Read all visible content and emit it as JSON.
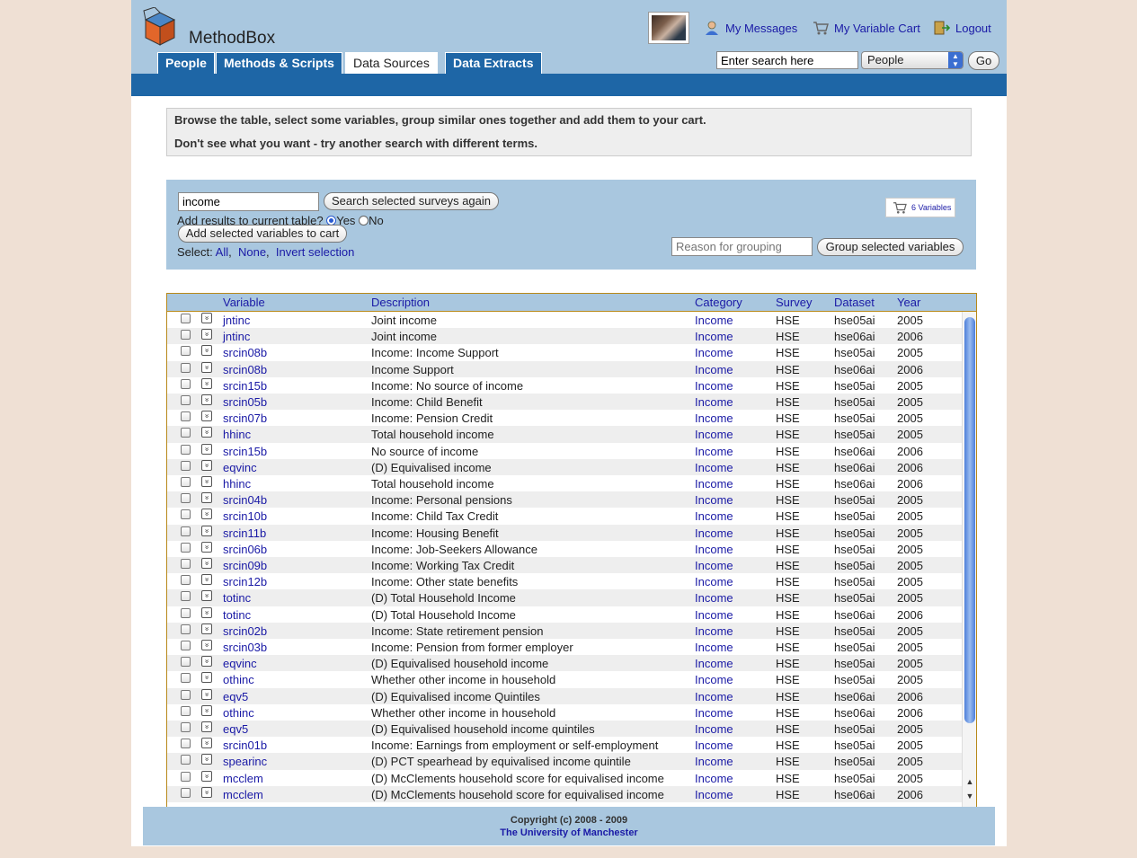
{
  "header": {
    "logo_text": "MethodBox",
    "nav_tabs": [
      {
        "label": "People",
        "active": false
      },
      {
        "label": "Methods & Scripts",
        "active": false
      },
      {
        "label": "Data Sources",
        "active": true
      },
      {
        "label": "Data Extracts",
        "active": false
      }
    ],
    "links": {
      "messages": "My Messages",
      "cart": "My Variable Cart",
      "logout": "Logout"
    },
    "search": {
      "value": "Enter search here",
      "scope": "People",
      "go_label": "Go"
    }
  },
  "info": {
    "line1": "Browse the table, select some variables, group similar ones together and add them to your cart.",
    "line2": "Don't see what you want - try another search with different terms."
  },
  "controls": {
    "search_value": "income",
    "search_again_label": "Search selected surveys again",
    "add_results_question": "Add results to current table?",
    "yes_label": "Yes",
    "no_label": "No",
    "add_to_cart_label": "Add selected variables to cart",
    "select_label": "Select:",
    "select_all": "All",
    "select_none": "None",
    "select_invert": "Invert selection",
    "sep1": ",",
    "sep2": ",",
    "cart_count_label": "6 Variables",
    "grouping_placeholder": "Reason for grouping",
    "group_button_label": "Group selected variables"
  },
  "table": {
    "columns": [
      "Variable",
      "Description",
      "Category",
      "Survey",
      "Dataset",
      "Year"
    ],
    "rows": [
      [
        "jntinc",
        "Joint income",
        "Income",
        "HSE",
        "hse05ai",
        "2005"
      ],
      [
        "jntinc",
        "Joint income",
        "Income",
        "HSE",
        "hse06ai",
        "2006"
      ],
      [
        "srcin08b",
        "Income: Income Support",
        "Income",
        "HSE",
        "hse05ai",
        "2005"
      ],
      [
        "srcin08b",
        "Income Support",
        "Income",
        "HSE",
        "hse06ai",
        "2006"
      ],
      [
        "srcin15b",
        "Income: No source of income",
        "Income",
        "HSE",
        "hse05ai",
        "2005"
      ],
      [
        "srcin05b",
        "Income: Child Benefit",
        "Income",
        "HSE",
        "hse05ai",
        "2005"
      ],
      [
        "srcin07b",
        "Income: Pension Credit",
        "Income",
        "HSE",
        "hse05ai",
        "2005"
      ],
      [
        "hhinc",
        "Total household income",
        "Income",
        "HSE",
        "hse05ai",
        "2005"
      ],
      [
        "srcin15b",
        "No source of income",
        "Income",
        "HSE",
        "hse06ai",
        "2006"
      ],
      [
        "eqvinc",
        "(D) Equivalised income",
        "Income",
        "HSE",
        "hse06ai",
        "2006"
      ],
      [
        "hhinc",
        "Total household income",
        "Income",
        "HSE",
        "hse06ai",
        "2006"
      ],
      [
        "srcin04b",
        "Income: Personal pensions",
        "Income",
        "HSE",
        "hse05ai",
        "2005"
      ],
      [
        "srcin10b",
        "Income: Child Tax Credit",
        "Income",
        "HSE",
        "hse05ai",
        "2005"
      ],
      [
        "srcin11b",
        "Income: Housing Benefit",
        "Income",
        "HSE",
        "hse05ai",
        "2005"
      ],
      [
        "srcin06b",
        "Income: Job-Seekers Allowance",
        "Income",
        "HSE",
        "hse05ai",
        "2005"
      ],
      [
        "srcin09b",
        "Income: Working Tax Credit",
        "Income",
        "HSE",
        "hse05ai",
        "2005"
      ],
      [
        "srcin12b",
        "Income: Other state benefits",
        "Income",
        "HSE",
        "hse05ai",
        "2005"
      ],
      [
        "totinc",
        "(D) Total Household Income",
        "Income",
        "HSE",
        "hse05ai",
        "2005"
      ],
      [
        "totinc",
        "(D) Total Household Income",
        "Income",
        "HSE",
        "hse06ai",
        "2006"
      ],
      [
        "srcin02b",
        "Income: State retirement pension",
        "Income",
        "HSE",
        "hse05ai",
        "2005"
      ],
      [
        "srcin03b",
        "Income: Pension from former employer",
        "Income",
        "HSE",
        "hse05ai",
        "2005"
      ],
      [
        "eqvinc",
        "(D) Equivalised household income",
        "Income",
        "HSE",
        "hse05ai",
        "2005"
      ],
      [
        "othinc",
        "Whether other income in household",
        "Income",
        "HSE",
        "hse05ai",
        "2005"
      ],
      [
        "eqv5",
        "(D) Equivalised income Quintiles",
        "Income",
        "HSE",
        "hse06ai",
        "2006"
      ],
      [
        "othinc",
        "Whether other income in household",
        "Income",
        "HSE",
        "hse06ai",
        "2006"
      ],
      [
        "eqv5",
        "(D) Equivalised household income quintiles",
        "Income",
        "HSE",
        "hse05ai",
        "2005"
      ],
      [
        "srcin01b",
        "Income: Earnings from employment or self-employment",
        "Income",
        "HSE",
        "hse05ai",
        "2005"
      ],
      [
        "spearinc",
        "(D) PCT spearhead by equivalised income quintile",
        "Income",
        "HSE",
        "hse05ai",
        "2005"
      ],
      [
        "mcclem",
        "(D) McClements household score for equivalised income",
        "Income",
        "HSE",
        "hse05ai",
        "2005"
      ],
      [
        "mcclem",
        "(D) McClements household score for equivalised income",
        "Income",
        "HSE",
        "hse06ai",
        "2006"
      ]
    ]
  },
  "footer": {
    "copyright": "Copyright (c) 2008 - 2009",
    "university": "The University of Manchester"
  },
  "colors": {
    "header_bg": "#a9c7df",
    "nav_blue": "#1e66a6",
    "link": "#1a1aa6",
    "table_border": "#b8891a"
  }
}
